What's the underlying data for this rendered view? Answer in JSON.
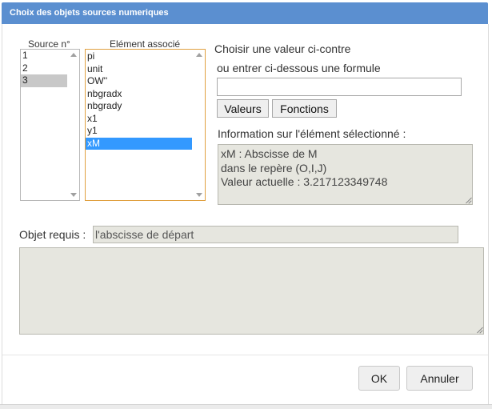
{
  "window": {
    "title": "Choix des objets sources numeriques"
  },
  "source_list": {
    "header": "Source n°",
    "items": [
      "1",
      "2",
      "3"
    ],
    "selected_index": 2
  },
  "element_list": {
    "header": "Elément associé",
    "items": [
      "pi",
      "unit",
      "OW''",
      "nbgradx",
      "nbgrady",
      "x1",
      "y1",
      "xM"
    ],
    "selected_index": 7
  },
  "right_panel": {
    "choose_label": "Choisir une valeur ci-contre",
    "formula_label": "ou entrer ci-dessous une formule",
    "formula_value": "",
    "valeurs_button": "Valeurs",
    "fonctions_button": "Fonctions",
    "info_label": "Information sur l'élément sélectionné :",
    "info_lines": [
      "xM : Abscisse de M",
      "dans le repère (O,I,J)",
      "Valeur actuelle : 3.217123349748"
    ]
  },
  "required": {
    "label": "Objet requis :",
    "value": "l'abscisse de départ"
  },
  "footer": {
    "ok_button": "OK",
    "cancel_button": "Annuler"
  }
}
